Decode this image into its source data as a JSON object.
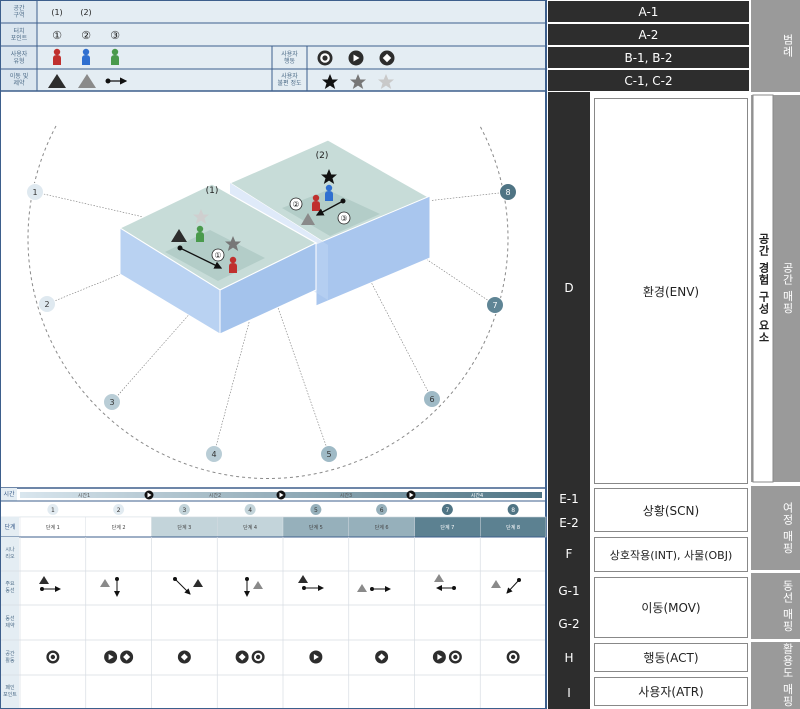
{
  "legend": {
    "rows": [
      {
        "label": "공간\n구역",
        "items": [
          "(1)",
          "(2)"
        ]
      },
      {
        "label": "터치\n포인트",
        "items": [
          "①",
          "②",
          "③"
        ]
      },
      {
        "label": "사용자\n유형",
        "right_label": "사용자\n행동"
      },
      {
        "label": "이동 및\n제약",
        "right_label": "사용자\n불편 정도"
      }
    ]
  },
  "scene": {
    "zones": [
      "(1)",
      "(2)"
    ],
    "touch_markers": [
      "①",
      "②",
      "③"
    ],
    "view_points": [
      "1",
      "2",
      "3",
      "4",
      "5",
      "6",
      "7",
      "8"
    ]
  },
  "timeline": {
    "header": "시간",
    "segments": [
      "시간1",
      "시간2",
      "시간3",
      "시간4"
    ],
    "step_numbers": [
      "1",
      "2",
      "3",
      "4",
      "5",
      "6",
      "7",
      "8"
    ],
    "step_row_label": "단계",
    "steps": [
      "단계 1",
      "단계 2",
      "단계 3",
      "단계 4",
      "단계 5",
      "단계 6",
      "단계 7",
      "단계 8"
    ],
    "row_labels": [
      "시나\n리오",
      "주요\n동선",
      "동선\n제약",
      "공간\n활동",
      "페인\n포인트"
    ]
  },
  "codes": [
    {
      "code": "A-1"
    },
    {
      "code": "A-2"
    },
    {
      "code": "B-1, B-2"
    },
    {
      "code": "C-1, C-2"
    },
    {
      "code": "D"
    },
    {
      "code": "E-1"
    },
    {
      "code": "E-2"
    },
    {
      "code": "F"
    },
    {
      "code": "G-1"
    },
    {
      "code": "G-2"
    },
    {
      "code": "H"
    },
    {
      "code": "I"
    }
  ],
  "components": [
    "환경(ENV)",
    "상황(SCN)",
    "상호작용(INT), 사물(OBJ)",
    "이동(MOV)",
    "행동(ACT)",
    "사용자(ATR)"
  ],
  "side_labels": {
    "legend": "범례",
    "spatial_mapping": "공간 매핑",
    "components": "공간 경험 구성 요소",
    "journey_mapping": "여정 매핑",
    "flow_mapping": "동선 매핑",
    "activity_mapping": "활용도 매핑"
  },
  "colors": {
    "navy": "#3d5f8c",
    "light_panel": "#e4edf3",
    "box_top": "#c7dcd8",
    "box_side": "#a9c6ee",
    "dark": "#2d2d2d",
    "gray": "#9a9a9a",
    "red": "#c0302e",
    "blue": "#2f6fd0",
    "green": "#4a9a4c"
  }
}
